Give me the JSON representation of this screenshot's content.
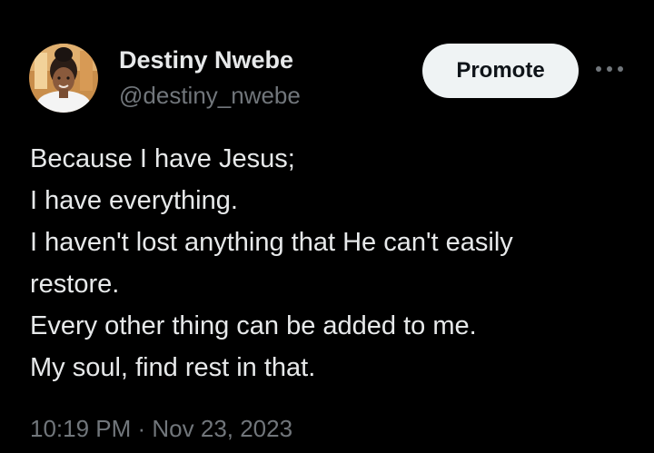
{
  "author": {
    "display_name": "Destiny Nwebe",
    "handle": "@destiny_nwebe",
    "avatar_icon": "user-avatar"
  },
  "actions": {
    "promote_label": "Promote",
    "more_icon": "more-horizontal-icon"
  },
  "tweet": {
    "lines": [
      "Because I have Jesus;",
      "I have everything.",
      "I haven't lost anything that He can't easily",
      "restore.",
      "Every other thing can be added to me.",
      "My soul, find rest in that."
    ]
  },
  "meta": {
    "timestamp": "10:19 PM · Nov 23, 2023"
  },
  "colors": {
    "background": "#000000",
    "primary_text": "#e7e9ea",
    "secondary_text": "#71767b",
    "button_bg": "#eff3f4"
  }
}
